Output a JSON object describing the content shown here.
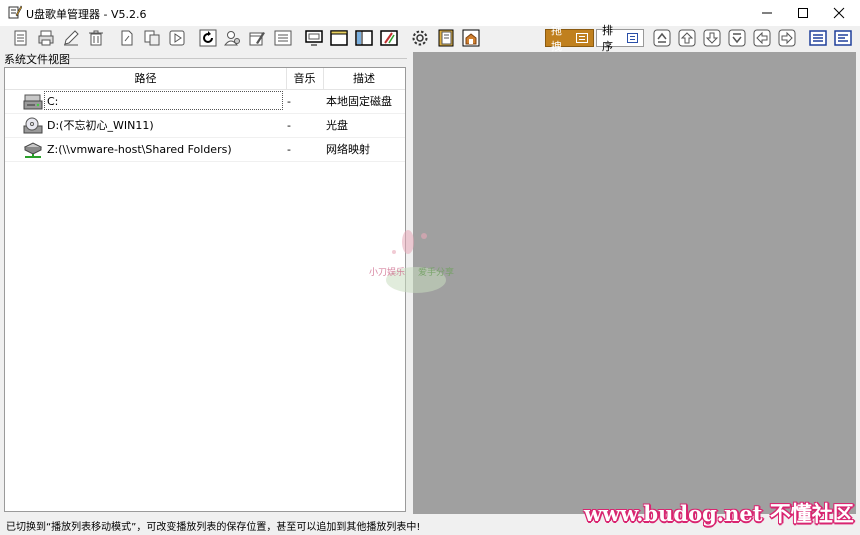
{
  "window": {
    "app_icon": "notepad-pencil-icon",
    "title": "U盘歌单管理器 - V5.2.6",
    "controls": [
      "minimize-icon",
      "maximize-icon",
      "close-icon"
    ]
  },
  "toolbar": {
    "left_icons": [
      "new-playlist-icon",
      "print-icon",
      "edit-icon",
      "delete-icon",
      "page-icon",
      "copy-icon",
      "play-icon",
      "refresh-icon",
      "user-icon",
      "calendar-edit-icon",
      "list-icon",
      "screen-icon",
      "window-icon",
      "columns-icon",
      "edit-box-icon",
      "settings-icon",
      "notebook-icon",
      "open-box-icon"
    ],
    "mode_drag_label": "拖拽",
    "mode_sort_label": "排序",
    "right_icons": [
      "move-top-icon",
      "move-up-icon",
      "move-down-icon",
      "move-bottom-icon",
      "move-left-icon",
      "move-right-icon",
      "list-view-icon",
      "detail-view-icon"
    ]
  },
  "file_view": {
    "group_label": "系统文件视图",
    "columns": {
      "path": "路径",
      "music": "音乐",
      "desc": "描述"
    },
    "rows": [
      {
        "icon": "hard-drive-icon",
        "path": "C:",
        "music": "-",
        "desc": "本地固定磁盘"
      },
      {
        "icon": "optical-drive-icon",
        "path": "D:(不忘初心_WIN11)",
        "music": "-",
        "desc": "光盘"
      },
      {
        "icon": "network-drive-icon",
        "path": "Z:(\\\\vmware-host\\Shared Folders)",
        "music": "-",
        "desc": "网络映射"
      }
    ]
  },
  "watermark": {
    "left": "小刀娱乐",
    "right": "爱手分享"
  },
  "status": {
    "text": "已切换到“播放列表移动模式”，可改变播放列表的保存位置，甚至可以追加到其他播放列表中!",
    "site": "www.budog.net 不懂社区"
  },
  "colors": {
    "accent_drag": "#c0801e",
    "right_panel": "#a0a0a0",
    "site_mark": "#d92470"
  }
}
